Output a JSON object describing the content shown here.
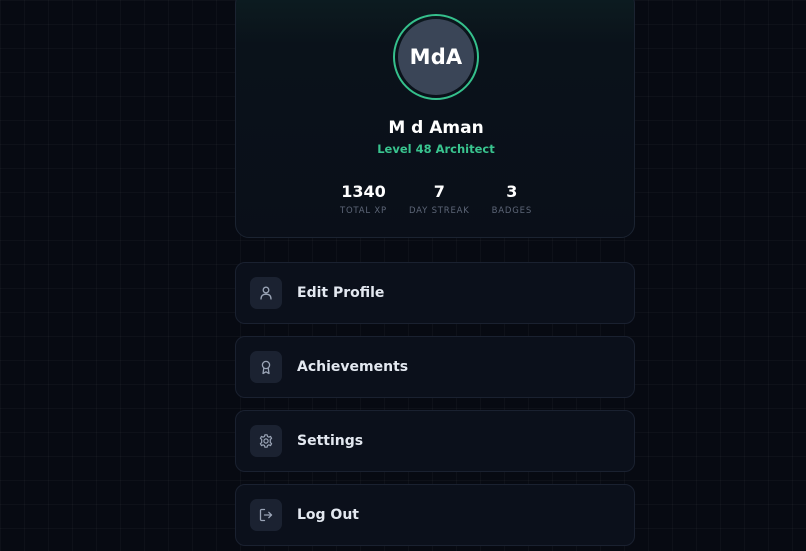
{
  "profile": {
    "initials": "MdA",
    "name": "M d Aman",
    "level": "Level 48 Architect",
    "accent_color": "#35c08c",
    "stats": [
      {
        "value": "1340",
        "label": "TOTAL XP"
      },
      {
        "value": "7",
        "label": "DAY STREAK"
      },
      {
        "value": "3",
        "label": "BADGES"
      }
    ]
  },
  "menu": {
    "items": [
      {
        "label": "Edit Profile",
        "icon": "user-icon"
      },
      {
        "label": "Achievements",
        "icon": "award-icon"
      },
      {
        "label": "Settings",
        "icon": "gear-icon"
      },
      {
        "label": "Log Out",
        "icon": "logout-icon"
      }
    ]
  }
}
